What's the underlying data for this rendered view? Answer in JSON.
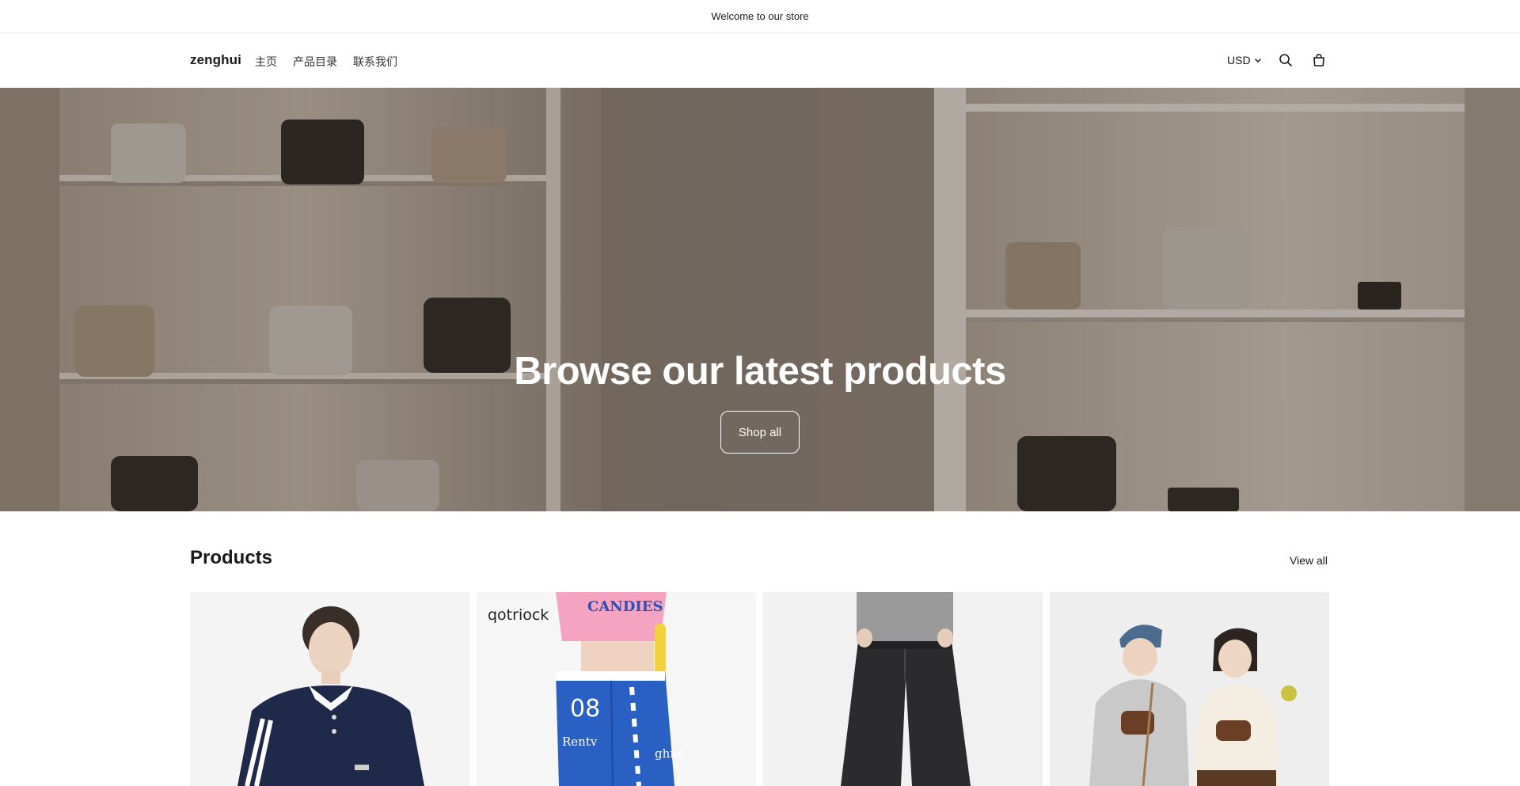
{
  "announcement": {
    "text": "Welcome to our store"
  },
  "header": {
    "brand": "zenghui",
    "nav": [
      {
        "label": "主页"
      },
      {
        "label": "产品目录"
      },
      {
        "label": "联系我们"
      }
    ],
    "currency": "USD",
    "icons": [
      "search-icon",
      "cart-icon",
      "chevron-down-icon"
    ]
  },
  "hero": {
    "title": "Browse our latest products",
    "button_label": "Shop all"
  },
  "products": {
    "title": "Products",
    "view_all_label": "View all",
    "items": [
      {
        "brand_mark": ""
      },
      {
        "brand_mark": "qotriock",
        "shirt_text": "CANDIES",
        "pants_text_1": "08",
        "pants_text_2": "Rentv",
        "pants_text_3": "ghno"
      },
      {
        "brand_mark": ""
      },
      {
        "brand_mark": ""
      }
    ]
  },
  "colors": {
    "text": "#1a1a1a",
    "border": "#e9e9e9",
    "hero_overlay": "#5a4f46",
    "white": "#ffffff"
  }
}
